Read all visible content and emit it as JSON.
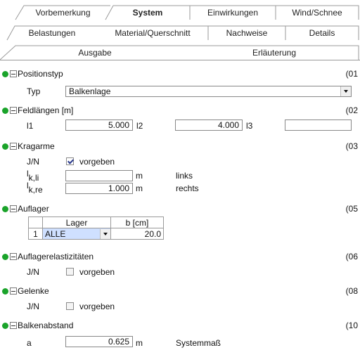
{
  "tabs": {
    "row1": [
      "Vorbemerkung",
      "System",
      "Einwirkungen",
      "Wind/Schnee"
    ],
    "row2": [
      "Belastungen",
      "Material/Querschnitt",
      "Nachweise",
      "Details"
    ],
    "row3": [
      "Ausgabe",
      "Erläuterung"
    ],
    "active": "System"
  },
  "sections": {
    "positionstyp": {
      "title": "Positionstyp",
      "num": "(01",
      "label": "Typ",
      "value": "Balkenlage"
    },
    "feldlaengen": {
      "title": "Feldlängen [m]",
      "num": "(02",
      "l1_label": "l1",
      "l1_value": "5.000",
      "l2_label": "l2",
      "l2_value": "4.000",
      "l3_label": "l3",
      "l3_value": ""
    },
    "kragarme": {
      "title": "Kragarme",
      "num": "(03",
      "jn_label": "J/N",
      "cb_label": "vorgeben",
      "checked": true,
      "lk_li_main": "l",
      "lk_li_sub": "k,li",
      "lk_li_value": "",
      "lk_li_unit": "m",
      "lk_li_side": "links",
      "lk_re_main": "l",
      "lk_re_sub": "k,re",
      "lk_re_value": "1.000",
      "lk_re_unit": "m",
      "lk_re_side": "rechts"
    },
    "auflager": {
      "title": "Auflager",
      "num": "(05",
      "col_lager": "Lager",
      "col_b": "b [cm]",
      "rows": [
        {
          "idx": "1",
          "lager": "ALLE",
          "b": "20.0"
        }
      ]
    },
    "auflagerelast": {
      "title": "Auflagerelastizitäten",
      "num": "(06",
      "jn_label": "J/N",
      "cb_label": "vorgeben",
      "checked": false
    },
    "gelenke": {
      "title": "Gelenke",
      "num": "(08",
      "jn_label": "J/N",
      "cb_label": "vorgeben",
      "checked": false
    },
    "balkenabstand": {
      "title": "Balkenabstand",
      "num": "(10",
      "a_label": "a",
      "a_value": "0.625",
      "a_unit": "m",
      "a_note": "Systemmaß"
    }
  },
  "colors": {
    "status_dot": "#1aa32a",
    "selected_cell": "#cfe0ff"
  }
}
